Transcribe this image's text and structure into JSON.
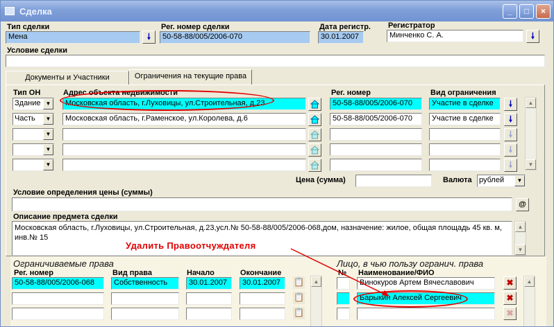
{
  "window": {
    "title": "Сделка",
    "buttons": {
      "minimize": "_",
      "maximize": "□",
      "close": "×"
    }
  },
  "header": {
    "deal_type_label": "Тип сделки",
    "deal_type_value": "Мена",
    "reg_number_label": "Рег. номер сделки",
    "reg_number_value": "50-58-88/005/2006-070",
    "reg_date_label": "Дата регистр.",
    "reg_date_value": "30.01.2007",
    "registrar_label": "Регистратор",
    "registrar_value": "Минченко С. А.",
    "condition_label": "Условие сделки",
    "condition_value": ""
  },
  "tabs": [
    {
      "label": "Документы и Участники"
    },
    {
      "label": "Ограничения на текущие права"
    }
  ],
  "objects": {
    "col_type": "Тип ОН",
    "col_address": "Адрес объекта недвижимости",
    "col_reg": "Рег. номер",
    "col_restriction": "Вид ограничения",
    "rows": [
      {
        "type": "Здание",
        "address": "Московская область, г.Луховицы, ул.Строительная, д.23",
        "reg": "50-58-88/005/2006-070",
        "restriction": "Участие в сделке"
      },
      {
        "type": "Часть",
        "address": "Московская область, г.Раменское, ул.Королева, д.6",
        "reg": "50-58-88/005/2006-070",
        "restriction": "Участие в сделке"
      },
      {
        "type": "",
        "address": "",
        "reg": "",
        "restriction": ""
      },
      {
        "type": "",
        "address": "",
        "reg": "",
        "restriction": ""
      },
      {
        "type": "",
        "address": "",
        "reg": "",
        "restriction": ""
      }
    ]
  },
  "price": {
    "label": "Цена (сумма)",
    "value": "",
    "currency_label": "Валюта",
    "currency_value": "рублей"
  },
  "price_condition": {
    "label": "Условие определения цены (суммы)",
    "value": "",
    "button": "@"
  },
  "description": {
    "label": "Описание предмета сделки",
    "value": "Московская область, г.Луховицы, ул.Строительная, д.23,усл.№ 50-58-88/005/2006-068,дом, назначение: жилое, общая площадь 45 кв. м, инв.№ 15"
  },
  "annotation": {
    "text": "Удалить Правоотчуждателя"
  },
  "restricted_rights": {
    "title": "Ограничиваемые права",
    "col_reg": "Рег. номер",
    "col_right": "Вид права",
    "col_start": "Начало",
    "col_end": "Окончание",
    "rows": [
      {
        "reg": "50-58-88/005/2006-068",
        "right": "Собственность",
        "start": "30.01.2007",
        "end": "30.01.2007"
      },
      {
        "reg": "",
        "right": "",
        "start": "",
        "end": ""
      },
      {
        "reg": "",
        "right": "",
        "start": "",
        "end": ""
      }
    ]
  },
  "beneficiaries": {
    "title": "Лицо, в чью пользу огранич. права",
    "col_num": "№",
    "col_name": "Наименование/ФИО",
    "rows": [
      {
        "num": "",
        "name": "Винокуров Артем Вячеславович"
      },
      {
        "num": "",
        "name": "Барыкин Алексей Сергеевич"
      },
      {
        "num": "",
        "name": ""
      }
    ]
  },
  "icons": {
    "down_arrow": "arrow-down-icon",
    "home": "house-icon",
    "delete_person": "delete-person-icon",
    "doc": "document-icon"
  },
  "colors": {
    "cyan": "#00ffff",
    "light_blue": "#a6caf0",
    "annotation_red": "#e00000"
  }
}
